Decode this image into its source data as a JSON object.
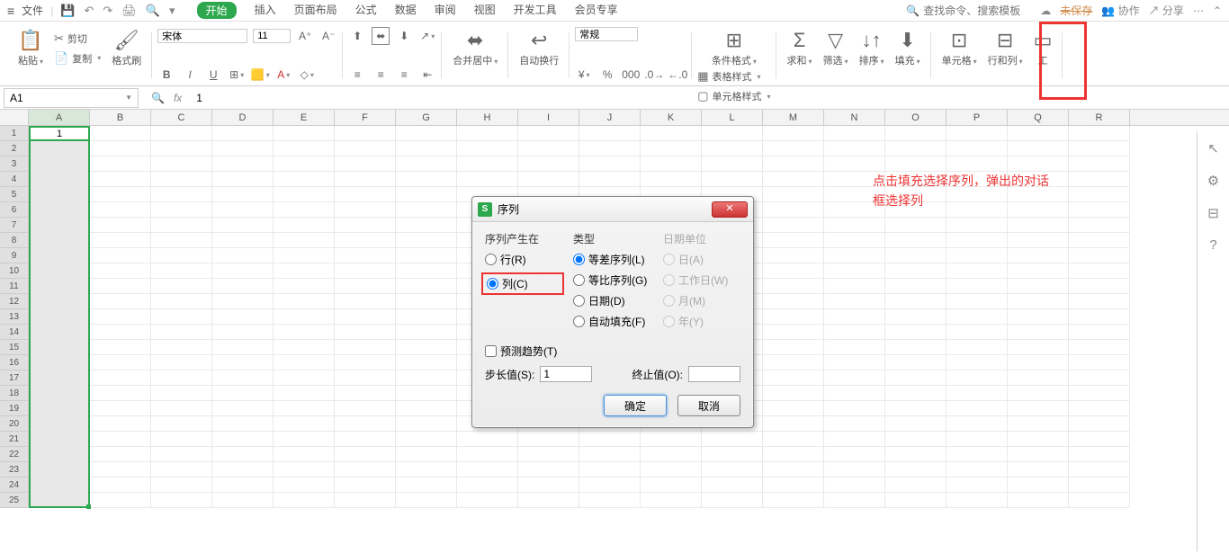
{
  "menubar": {
    "file": "文件",
    "tabs": [
      "开始",
      "插入",
      "页面布局",
      "公式",
      "数据",
      "审阅",
      "视图",
      "开发工具",
      "会员专享"
    ],
    "active_tab": 0,
    "search_placeholder": "查找命令、搜索模板",
    "unsaved": "未保存",
    "collab": "协作",
    "share": "分享"
  },
  "ribbon": {
    "cut": "剪切",
    "copy": "复制",
    "paste": "粘贴",
    "format_painter": "格式刷",
    "font_name": "宋体",
    "font_size": "11",
    "merge": "合并居中",
    "wrap": "自动换行",
    "number_format": "常规",
    "cond": "条件格式",
    "table_style": "表格样式",
    "cell_style": "单元格样式",
    "sum": "求和",
    "filter": "筛选",
    "sort": "排序",
    "fill": "填充",
    "cells": "单元格",
    "rowcol": "行和列",
    "worksheet": "工"
  },
  "formula_bar": {
    "name": "A1",
    "value": "1"
  },
  "grid": {
    "cols": [
      "A",
      "B",
      "C",
      "D",
      "E",
      "F",
      "G",
      "H",
      "I",
      "J",
      "K",
      "L",
      "M",
      "N",
      "O",
      "P",
      "Q",
      "R"
    ],
    "rows": 25,
    "a1_value": "1"
  },
  "annotation": {
    "line1": "点击填充选择序列，弹出的对话",
    "line2": "框选择列"
  },
  "dialog": {
    "title": "序列",
    "section_in": "序列产生在",
    "opt_row": "行(R)",
    "opt_col": "列(C)",
    "section_type": "类型",
    "type_arith": "等差序列(L)",
    "type_geo": "等比序列(G)",
    "type_date": "日期(D)",
    "type_auto": "自动填充(F)",
    "section_unit": "日期单位",
    "unit_day": "日(A)",
    "unit_wday": "工作日(W)",
    "unit_month": "月(M)",
    "unit_year": "年(Y)",
    "predict": "预测趋势(T)",
    "step_label": "步长值(S):",
    "step_value": "1",
    "stop_label": "终止值(O):",
    "stop_value": "",
    "ok": "确定",
    "cancel": "取消"
  }
}
